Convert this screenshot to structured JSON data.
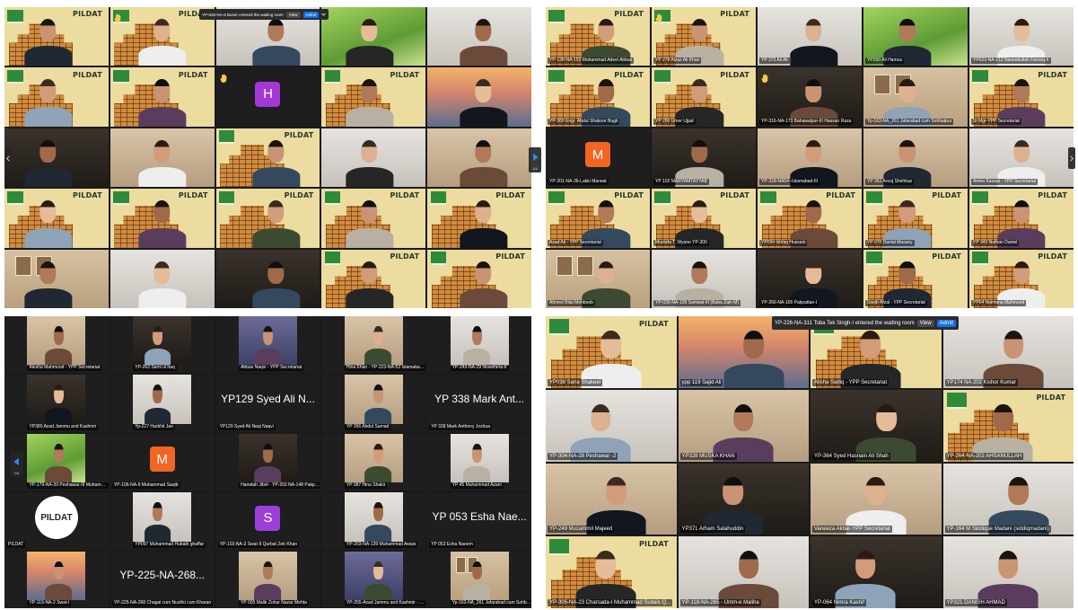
{
  "backdrop": {
    "logo_text": "PILDAT"
  },
  "nav": {
    "page": "1/4"
  },
  "avatar_colors": {
    "H": "#a338d6",
    "M": "#f26522",
    "S": "#9b3fd6"
  },
  "accent": {
    "admit_button": "#0e72ed"
  },
  "quadrants": [
    {
      "notification": {
        "text": "YP-025-NA-8 Buner entered the waiting room",
        "view": "View",
        "admit": "Admit"
      },
      "tiles": [
        {},
        {
          "hand": true
        },
        {},
        {},
        {},
        {},
        {},
        {
          "avatar": "H",
          "hand": true
        },
        {},
        {},
        {},
        {},
        {},
        {},
        {},
        {},
        {},
        {},
        {},
        {},
        {},
        {},
        {},
        {},
        {}
      ]
    },
    {
      "tiles": [
        {
          "label": "YP-128-NA-153 Muhammad Adeel Abbas"
        },
        {
          "label": "YP 278 Aizaz Ali Khan",
          "hand": true
        },
        {
          "label": "YP 373 Ali Ali"
        },
        {
          "label": "YP260 Ali Hamza"
        },
        {
          "label": "YP023-NA-212 Naseebullah Farooq-II"
        },
        {
          "label": "YP-369 Engr. Abdul Shakoor Bugti"
        },
        {
          "label": "YP 200 Umer Ujjad"
        },
        {
          "label": "YP-316-NA-173 Bahawalpur-III Hassan Raza",
          "hand": true
        },
        {
          "label": "Yp-163-NA_261 Jafarabad cum Sohbatpur"
        },
        {
          "label": "Sr.Mgr-YPP Secretariat"
        },
        {
          "label": "YP-201-NA-36-Lakki Marwat",
          "avatar": "M"
        },
        {
          "label": "YP 102 MARYAMTAYYAB"
        },
        {
          "label": "YP-318-NA54--Islamabad-III"
        },
        {
          "label": "YP 361 Arooj Shehbaz"
        },
        {
          "label": "Amna Kausar - YPP Secretariat"
        },
        {
          "label": "Asad Ali - YPP Secretariat"
        },
        {
          "label": "Mustafa T. Wyane YP-300"
        },
        {
          "label": "YP094 Ishfaq Hussain"
        },
        {
          "label": "YP 070 Danial Massey"
        },
        {
          "label": "YP 343 Nathan Daniel"
        },
        {
          "label": "Ahmed Bilal Mehboob"
        },
        {
          "label": "YP-030-NA-109 Sahiwal-III (Baba Zain M)"
        },
        {
          "label": "YP-266-NA-165 Pakpattan-I"
        },
        {
          "label": "Saqib Afzal - YPP Secretariat"
        },
        {
          "label": "YP04 Naimana Mahmood"
        }
      ]
    },
    {
      "tiles": [
        {
          "label": "Alesha Mahmood - YPP Secretariat"
        },
        {
          "label": "YP-263 Sami ul haq"
        },
        {
          "label": "Abbas Naqvi - YPP Secretariat"
        },
        {
          "label": "Hina Khan - YP-223-NA-53 Islamabad-II"
        },
        {
          "label": "YP-243-NA-29 Nowshera-II"
        },
        {
          "label": "YP380 Azad Jammu and Kashmir"
        },
        {
          "label": "Yp-227 Harbhit Jan"
        },
        {
          "label": "YP129 Syed Ali Naqi Naqvi",
          "big_name": "YP129 Syed Ali N..."
        },
        {
          "label": "YP 266 Abdul Samad"
        },
        {
          "label": "YP 338 Mark Anthony Joshua",
          "big_name": "YP 338 Mark Ant..."
        },
        {
          "label": "YP-179-NA-39 Peshawar-III Muhammad Adin"
        },
        {
          "label": "YP-106-NA-9 Muhammad Saqib",
          "avatar": "M"
        },
        {
          "label": "Hamdah Jibril - YP-203 NA-148 Pakpattan-II"
        },
        {
          "label": "YP 087 Hina Shakir"
        },
        {
          "label": "YP 45 Muhammad Azam"
        },
        {
          "label": "PILDAT",
          "logo_text": "PILDAT"
        },
        {
          "label": "YP097 Muhammad Hubaib ghaffar"
        },
        {
          "label": "YP-103-NA-3 Swat-II Qurbat Zeb Khan",
          "avatar": "S"
        },
        {
          "label": "YP-203-NA-139 Muhammad Awais"
        },
        {
          "label": "YP 053 Esha Naeem",
          "big_name": "YP 053 Esha Nae..."
        },
        {
          "label": "YP-119-NA-2 Swat-I"
        },
        {
          "label": "YP-225-NA-268 Chagai cum Nushki cum Kharan",
          "big_name": "YP-225-NA-268..."
        },
        {
          "label": "YP 005 Malik Zohar Nazar Mehta"
        },
        {
          "label": "YP-255-Azad Jammu and Kashmir - Muhammad ..."
        },
        {
          "label": "Yp-163-NA_261 Jafarabad cum Sohbatpur"
        }
      ]
    },
    {
      "notification": {
        "text": "YP-226-NA-311 Toba Tek Singh-I entered the waiting room",
        "view": "View",
        "admit": "Admit"
      },
      "tiles": [
        {
          "label": "YP038 Sana Shakeel"
        },
        {
          "label": "ypp 119 Sajid Ali"
        },
        {
          "label": "Alisha Sadiq - YPP Secretariat"
        },
        {
          "label": "YP174 NA 202 Kishor Kumar"
        },
        {
          "label": "YP-304-NA-28 Peshawar -2"
        },
        {
          "label": "YP328 MUSKA KHAN"
        },
        {
          "label": "YP-364 Syed Hasnain Ali Shah"
        },
        {
          "label": "YP-264-NA-202 AHSANULLAH"
        },
        {
          "label": "YP-249 Muzammil Majeed"
        },
        {
          "label": "YP371 Arham Salahuddin"
        },
        {
          "label": "Vaneeza Akbar-YPP Secretariat"
        },
        {
          "label": "YP-164 M Siddique Madani (siddiqmadani)"
        },
        {
          "label": "YP-305-NA-23 Charsada-I Muhammad Sudais Q..."
        },
        {
          "label": "YP-118-NA-265 - Umm-e Maliha"
        },
        {
          "label": "YP-064 Nimra Kashif"
        },
        {
          "label": "YP321 DANISH AHMAD"
        }
      ]
    }
  ]
}
